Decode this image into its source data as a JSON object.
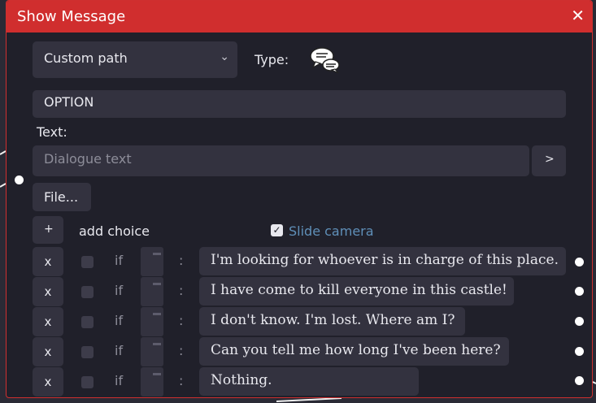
{
  "window": {
    "title": "Show Message",
    "close_glyph": "✕"
  },
  "dropdown": {
    "selected": "Custom path",
    "chevron": "⌄"
  },
  "type_label": "Type:",
  "type_icon": "speech-bubbles-icon",
  "option_field": {
    "value": "OPTION"
  },
  "text_label": "Text:",
  "dialogue": {
    "placeholder": "Dialogue text",
    "arrow_label": ">"
  },
  "file_button": "File...",
  "add_choice": {
    "plus": "+",
    "label": "add choice"
  },
  "slide_camera": {
    "label": "Slide camera",
    "checked": true,
    "check_glyph": "✓"
  },
  "choice_row": {
    "remove": "x",
    "if_label": "if",
    "colon": ":"
  },
  "choices": [
    {
      "text": "I'm looking for whoever is in charge of this place."
    },
    {
      "text": "I have come to kill everyone in this castle!"
    },
    {
      "text": "I don't know. I'm lost. Where am I?"
    },
    {
      "text": "Can you tell me how long I've been here?"
    },
    {
      "text": "Nothing."
    }
  ],
  "colors": {
    "accent": "#d02e2e",
    "panel": "#20202a",
    "control": "#33323f",
    "link": "#5f8fb8"
  }
}
